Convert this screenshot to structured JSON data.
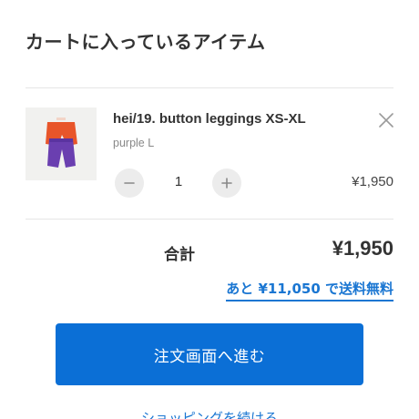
{
  "cart": {
    "title": "カートに入っているアイテム"
  },
  "item": {
    "name": "hei/19. button leggings XS-XL",
    "variant": "purple L",
    "quantity": "1",
    "line_price": "¥1,950",
    "thumbnail_colors": {
      "top_garment": "#e8552a",
      "bottom_garment": "#6a3fb0",
      "background": "#f1f1ef"
    }
  },
  "summary": {
    "total_label": "合計",
    "total_value": "¥1,950",
    "shipping_note": "あと ¥11,050 で送料無料"
  },
  "actions": {
    "checkout_label": "注文画面へ進む",
    "continue_label": "ショッピングを続ける"
  },
  "colors": {
    "accent": "#0b6fd6",
    "link": "#1a76d2"
  }
}
